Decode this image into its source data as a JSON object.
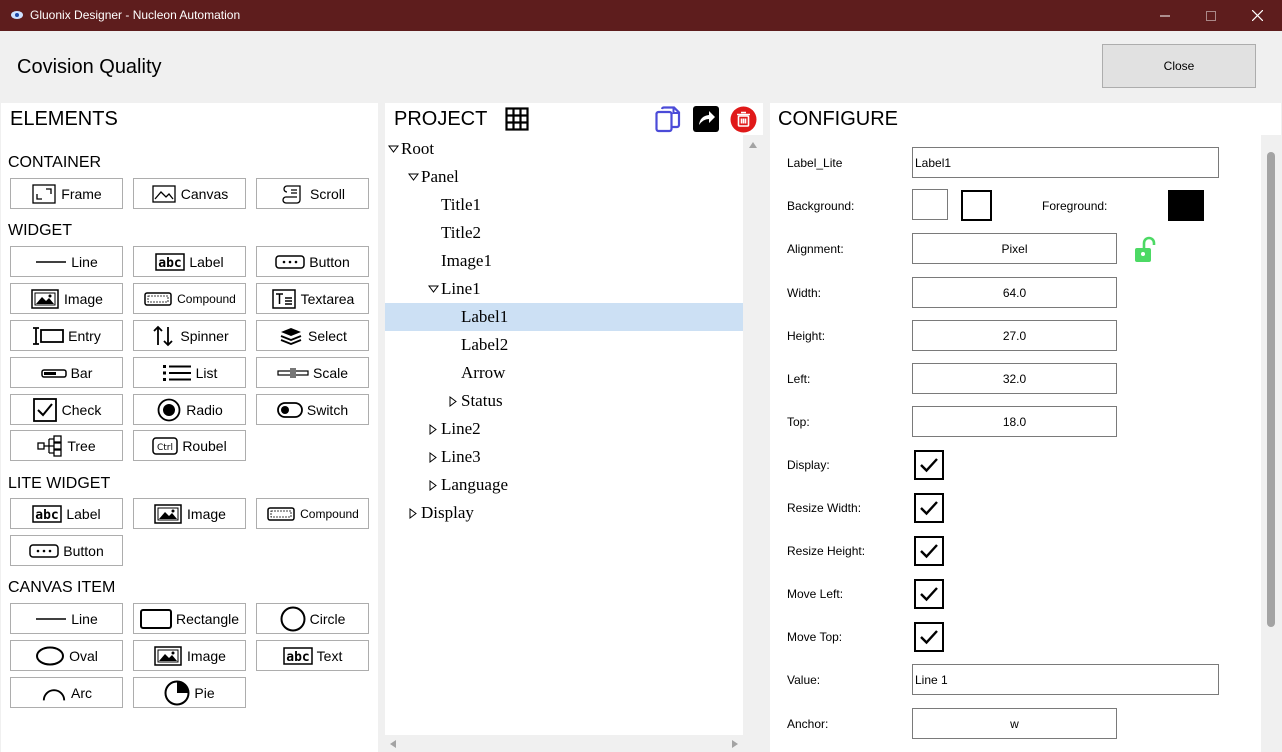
{
  "window": {
    "title": "Gluonix Designer - Nucleon Automation",
    "app_title": "Covision Quality",
    "close_label": "Close"
  },
  "elements": {
    "title": "ELEMENTS",
    "sections": {
      "container": "CONTAINER",
      "widget": "WIDGET",
      "lite_widget": "LITE WIDGET",
      "canvas_item": "CANVAS ITEM"
    },
    "container": [
      {
        "label": "Frame",
        "icon": "frame-icon"
      },
      {
        "label": "Canvas",
        "icon": "canvas-icon"
      },
      {
        "label": "Scroll",
        "icon": "scroll-icon"
      }
    ],
    "widget": [
      {
        "label": "Line",
        "icon": "line-icon"
      },
      {
        "label": "Label",
        "icon": "label-icon"
      },
      {
        "label": "Button",
        "icon": "button-icon"
      },
      {
        "label": "Image",
        "icon": "image-icon"
      },
      {
        "label": "Compound",
        "icon": "compound-icon"
      },
      {
        "label": "Textarea",
        "icon": "textarea-icon"
      },
      {
        "label": "Entry",
        "icon": "entry-icon"
      },
      {
        "label": "Spinner",
        "icon": "spinner-icon"
      },
      {
        "label": "Select",
        "icon": "select-icon"
      },
      {
        "label": "Bar",
        "icon": "bar-icon"
      },
      {
        "label": "List",
        "icon": "list-icon"
      },
      {
        "label": "Scale",
        "icon": "scale-icon"
      },
      {
        "label": "Check",
        "icon": "check-icon"
      },
      {
        "label": "Radio",
        "icon": "radio-icon"
      },
      {
        "label": "Switch",
        "icon": "switch-icon"
      },
      {
        "label": "Tree",
        "icon": "tree-icon"
      },
      {
        "label": "Roubel",
        "icon": "roubel-icon"
      }
    ],
    "lite_widget": [
      {
        "label": "Label",
        "icon": "label-icon"
      },
      {
        "label": "Image",
        "icon": "image-icon"
      },
      {
        "label": "Compound",
        "icon": "compound-icon"
      },
      {
        "label": "Button",
        "icon": "button-icon"
      }
    ],
    "canvas_item": [
      {
        "label": "Line",
        "icon": "line-icon"
      },
      {
        "label": "Rectangle",
        "icon": "rectangle-icon"
      },
      {
        "label": "Circle",
        "icon": "circle-icon"
      },
      {
        "label": "Oval",
        "icon": "oval-icon"
      },
      {
        "label": "Image",
        "icon": "image-icon"
      },
      {
        "label": "Text",
        "icon": "text-icon"
      },
      {
        "label": "Arc",
        "icon": "arc-icon"
      },
      {
        "label": "Pie",
        "icon": "pie-icon"
      }
    ]
  },
  "project": {
    "title": "PROJECT",
    "tree": [
      {
        "label": "Root",
        "depth": 0,
        "toggle": "expanded",
        "selected": false
      },
      {
        "label": "Panel",
        "depth": 1,
        "toggle": "expanded",
        "selected": false
      },
      {
        "label": "Title1",
        "depth": 2,
        "toggle": "none",
        "selected": false
      },
      {
        "label": "Title2",
        "depth": 2,
        "toggle": "none",
        "selected": false
      },
      {
        "label": "Image1",
        "depth": 2,
        "toggle": "none",
        "selected": false
      },
      {
        "label": "Line1",
        "depth": 2,
        "toggle": "expanded",
        "selected": false
      },
      {
        "label": "Label1",
        "depth": 3,
        "toggle": "none",
        "selected": true
      },
      {
        "label": "Label2",
        "depth": 3,
        "toggle": "none",
        "selected": false
      },
      {
        "label": "Arrow",
        "depth": 3,
        "toggle": "none",
        "selected": false
      },
      {
        "label": "Status",
        "depth": 3,
        "toggle": "collapsed",
        "selected": false
      },
      {
        "label": "Line2",
        "depth": 2,
        "toggle": "collapsed",
        "selected": false
      },
      {
        "label": "Line3",
        "depth": 2,
        "toggle": "collapsed",
        "selected": false
      },
      {
        "label": "Language",
        "depth": 2,
        "toggle": "collapsed",
        "selected": false
      },
      {
        "label": "Display",
        "depth": 1,
        "toggle": "collapsed",
        "selected": false
      }
    ]
  },
  "configure": {
    "title": "CONFIGURE",
    "label_lite_label": "Label_Lite",
    "label_lite_value": "Label1",
    "background_label": "Background:",
    "foreground_label": "Foreground:",
    "alignment_label": "Alignment:",
    "alignment_value": "Pixel",
    "width_label": "Width:",
    "width_value": "64.0",
    "height_label": "Height:",
    "height_value": "27.0",
    "left_label": "Left:",
    "left_value": "32.0",
    "top_label": "Top:",
    "top_value": "18.0",
    "display_label": "Display:",
    "resize_width_label": "Resize Width:",
    "resize_height_label": "Resize Height:",
    "move_left_label": "Move Left:",
    "move_top_label": "Move Top:",
    "value_label": "Value:",
    "value_value": "Line 1",
    "anchor_label": "Anchor:",
    "anchor_value": "w",
    "display_checked": true,
    "resize_width_checked": true,
    "resize_height_checked": true,
    "move_left_checked": true,
    "move_top_checked": true,
    "foreground_color": "#000000",
    "lock_color": "#4cd964"
  },
  "colors": {
    "titlebar": "#5e1d1d",
    "selection": "#cce0f4",
    "copy_icon": "#4b4bd8",
    "delete_icon": "#e01919"
  }
}
